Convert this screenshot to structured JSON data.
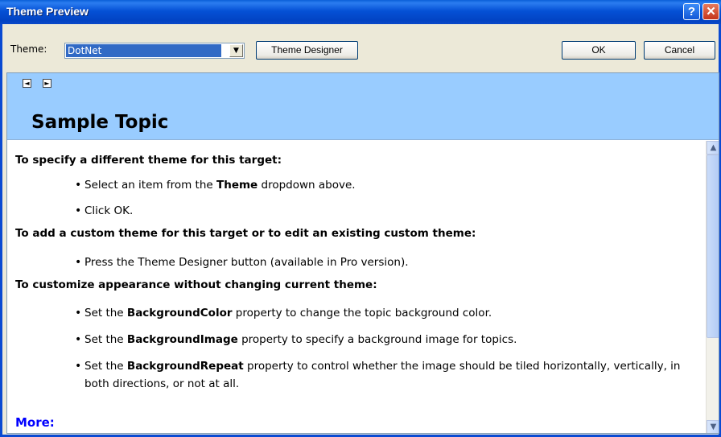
{
  "window": {
    "title": "Theme Preview",
    "help_glyph": "?",
    "close_glyph": "✕"
  },
  "toolbar": {
    "theme_label": "Theme:",
    "theme_value": "DotNet",
    "theme_designer_label": "Theme Designer",
    "ok_label": "OK",
    "cancel_label": "Cancel"
  },
  "topic": {
    "nav_prev": "◄",
    "nav_next": "►",
    "title": "Sample Topic",
    "sections": [
      {
        "heading": "To specify a different theme for this target:",
        "items": [
          {
            "pre": "Select an item from the ",
            "bold": "Theme",
            "post": " dropdown above."
          },
          {
            "pre": "Click OK.",
            "bold": "",
            "post": ""
          }
        ]
      },
      {
        "heading": "To add a custom theme for this target or to edit an existing custom theme:",
        "items": [
          {
            "pre": "Press the Theme Designer button (available in Pro version).",
            "bold": "",
            "post": ""
          }
        ]
      },
      {
        "heading": "To customize appearance without changing current theme:",
        "items": [
          {
            "pre": "Set the ",
            "bold": "BackgroundColor",
            "post": " property to change the topic background color."
          },
          {
            "pre": "Set the ",
            "bold": "BackgroundImage",
            "post": " property to specify a background image for topics."
          },
          {
            "pre": "Set the ",
            "bold": "BackgroundRepeat",
            "post": " property to control whether the image should be tiled horizontally, vertically, in both directions, or not at all."
          }
        ]
      }
    ],
    "more_label": "More:"
  },
  "colors": {
    "title_bar": "#0551d6",
    "banner": "#99ccff",
    "selection": "#316ac5",
    "link": "#0000ff"
  }
}
